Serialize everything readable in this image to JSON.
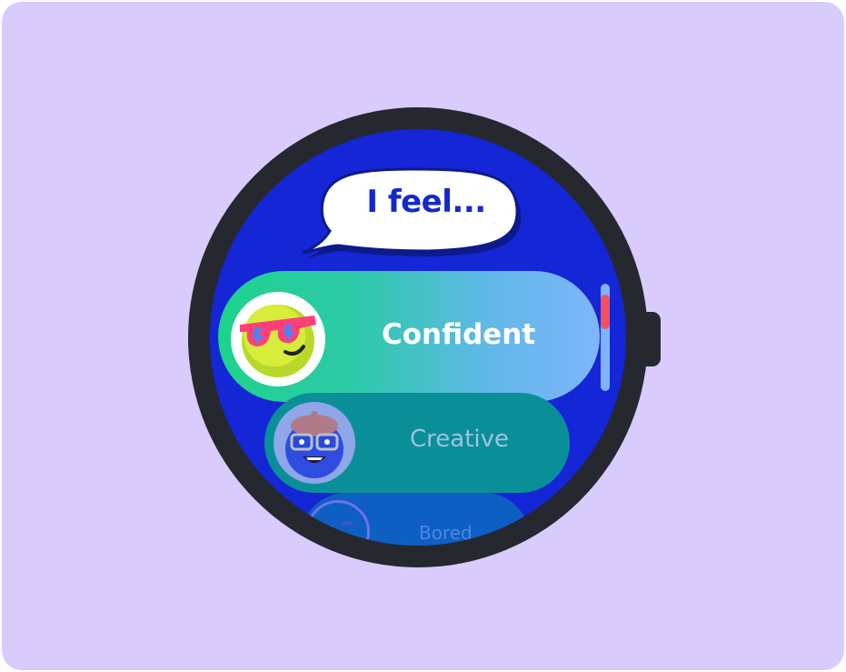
{
  "prompt": {
    "text": "I feel..."
  },
  "moods": [
    {
      "label": "Confident",
      "icon": "cool-sunglasses-emoji-icon",
      "selected": true
    },
    {
      "label": "Creative",
      "icon": "artist-beret-glasses-emoji-icon",
      "selected": false
    },
    {
      "label": "Bored",
      "icon": "bored-emoji-icon",
      "selected": false
    }
  ],
  "scroll": {
    "position": 0.15
  },
  "colors": {
    "background": "#d9ccfd",
    "bezel": "#26282f",
    "screen": "#1426d6",
    "prompt_text": "#1328cc",
    "confident_gradient_start": "#1dd38b",
    "confident_gradient_end": "#7fb5ff",
    "creative_row": "#0a8f99",
    "bored_row": "#0e5fc4",
    "scroll_thumb": "#f2515f"
  }
}
